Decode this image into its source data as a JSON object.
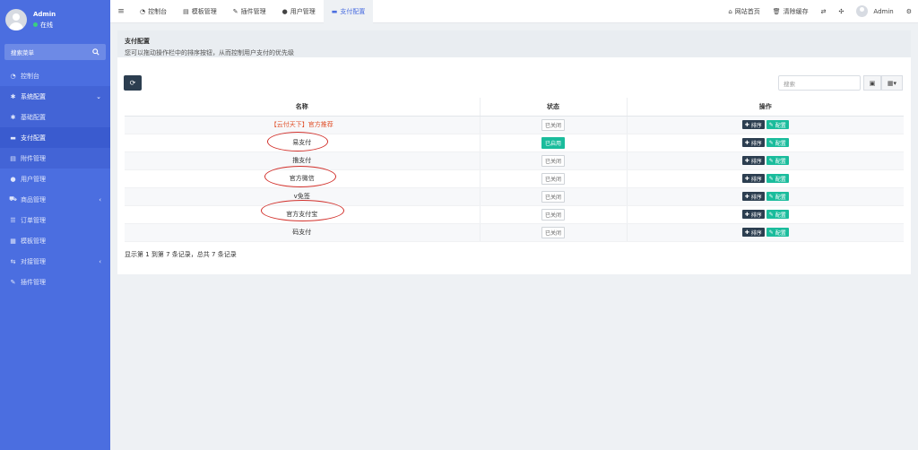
{
  "user": {
    "name": "Admin",
    "status": "在线"
  },
  "sidebar": {
    "search_label": "搜索菜单",
    "items": [
      {
        "label": "控制台",
        "icon": "dashboard-icon"
      },
      {
        "label": "系统配置",
        "icon": "gear-icon"
      },
      {
        "label": "基础配置",
        "icon": "gear-icon"
      },
      {
        "label": "支付配置",
        "icon": "list-icon"
      },
      {
        "label": "附件管理",
        "icon": "file-icon"
      },
      {
        "label": "用户管理",
        "icon": "user-icon"
      },
      {
        "label": "商品管理",
        "icon": "cart-icon"
      },
      {
        "label": "订单管理",
        "icon": "list-icon"
      },
      {
        "label": "模板管理",
        "icon": "template-icon"
      },
      {
        "label": "对接管理",
        "icon": "link-icon"
      },
      {
        "label": "插件管理",
        "icon": "plugin-icon"
      }
    ]
  },
  "topbar": {
    "tabs": [
      {
        "label": "控制台"
      },
      {
        "label": "模板管理"
      },
      {
        "label": "插件管理"
      },
      {
        "label": "用户管理"
      },
      {
        "label": "支付配置"
      }
    ],
    "site_home": "网站首页",
    "clear_cache": "清除缓存",
    "username": "Admin"
  },
  "panel": {
    "title": "支付配置",
    "description": "您可以拖动操作栏中的排序按钮，从而控制用户支付的优先级",
    "search_placeholder": "搜索"
  },
  "table": {
    "headers": [
      "名称",
      "状态",
      "操作"
    ],
    "rows": [
      {
        "name": "【云付天下】官方推荐",
        "status": "已关闭"
      },
      {
        "name": "易支付",
        "status": "已启用"
      },
      {
        "name": "撸支付",
        "status": "已关闭"
      },
      {
        "name": "官方微信",
        "status": "已关闭"
      },
      {
        "name": "v免签",
        "status": "已关闭"
      },
      {
        "name": "官方支付宝",
        "status": "已关闭"
      },
      {
        "name": "码支付",
        "status": "已关闭"
      }
    ],
    "sort_label": "排序",
    "config_label": "配置"
  },
  "footer": {
    "summary": "显示第 1 到第 7 条记录，总共 7 条记录"
  },
  "colors": {
    "sidebar": "#4b6ee0",
    "accent": "#1abc9c",
    "dark": "#2c3e50",
    "highlight": "#d2312c"
  }
}
